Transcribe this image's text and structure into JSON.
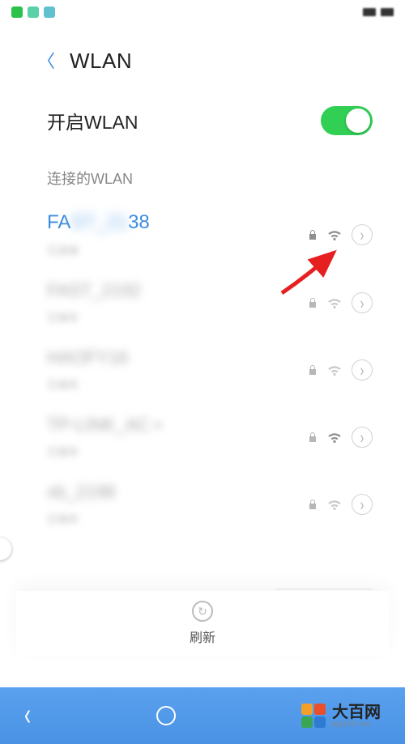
{
  "header": {
    "title": "WLAN"
  },
  "wlan_toggle": {
    "label": "开启WLAN",
    "enabled": true
  },
  "section": {
    "connected_label": "连接的WLAN"
  },
  "connected": {
    "ssid_prefix": "FA",
    "ssid_suffix": "38",
    "sub": "已连接"
  },
  "networks": [
    {
      "ssid": "FAST_2192",
      "sub": "已保存"
    },
    {
      "ssid": "HAOFY16",
      "sub": "已保存"
    },
    {
      "ssid": "TP-LINK_AC ▪",
      "sub": "已保存"
    },
    {
      "ssid": "xb_2198",
      "sub": "已保存"
    }
  ],
  "refresh": {
    "label": "刷新"
  },
  "brand": {
    "cn": "大百网",
    "en": "big100.net"
  }
}
